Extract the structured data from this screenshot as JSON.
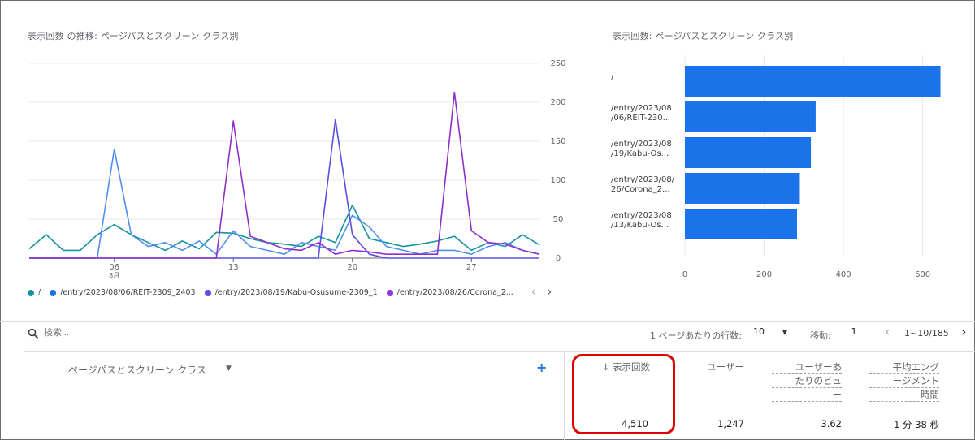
{
  "line_chart": {
    "title": "表示回数 の推移: ページパスとスクリーン クラス別",
    "y_ticks": [
      "250",
      "200",
      "150",
      "100",
      "50",
      "0"
    ],
    "x_ticks": [
      "06",
      "13",
      "20",
      "27"
    ],
    "x_sub": "8月",
    "legend": [
      {
        "label": "/",
        "color": "#1a73e8"
      },
      {
        "label": "/entry/2023/08/06/REIT-2309_2403",
        "color": "#4285f4"
      },
      {
        "label": "/entry/2023/08/19/Kabu-Osusume-2309_1",
        "color": "#5a4fe0"
      },
      {
        "label": "/entry/2023/08/26/Corona_2...",
        "color": "#9334e6"
      }
    ],
    "nav_prev": "‹",
    "nav_next": "›"
  },
  "chart_data": [
    {
      "type": "line",
      "title": "表示回数 の推移: ページパスとスクリーン クラス別",
      "x": [
        "08-01",
        "08-02",
        "08-03",
        "08-04",
        "08-05",
        "08-06",
        "08-07",
        "08-08",
        "08-09",
        "08-10",
        "08-11",
        "08-12",
        "08-13",
        "08-14",
        "08-15",
        "08-16",
        "08-17",
        "08-18",
        "08-19",
        "08-20",
        "08-21",
        "08-22",
        "08-23",
        "08-24",
        "08-25",
        "08-26",
        "08-27",
        "08-28",
        "08-29",
        "08-30",
        "08-31"
      ],
      "ylim": [
        0,
        250
      ],
      "series": [
        {
          "name": "/",
          "color": "#12939a",
          "values": [
            12,
            30,
            10,
            10,
            30,
            43,
            30,
            20,
            10,
            22,
            12,
            33,
            32,
            25,
            20,
            18,
            15,
            28,
            20,
            68,
            25,
            20,
            15,
            18,
            22,
            28,
            10,
            20,
            15,
            30,
            17
          ]
        },
        {
          "name": "/entry/2023/08/06/REIT-2309_2403",
          "color": "#4f8ff0",
          "values": [
            0,
            0,
            0,
            0,
            0,
            140,
            30,
            15,
            20,
            10,
            22,
            5,
            35,
            15,
            10,
            5,
            20,
            15,
            10,
            55,
            40,
            15,
            10,
            5,
            10,
            10,
            5,
            15,
            20,
            10,
            5
          ]
        },
        {
          "name": "/entry/2023/08/19/Kabu-Osusume-2309_1",
          "color": "#5a4fe0",
          "values": [
            0,
            0,
            0,
            0,
            0,
            0,
            0,
            0,
            0,
            0,
            0,
            0,
            0,
            0,
            0,
            0,
            0,
            0,
            178,
            30,
            5,
            0,
            0,
            0,
            0,
            0,
            0,
            0,
            0,
            0,
            0
          ]
        },
        {
          "name": "/entry/2023/08/26/Corona_2...",
          "color": "#8e2fc9",
          "values": [
            0,
            0,
            0,
            0,
            0,
            0,
            0,
            0,
            0,
            0,
            0,
            0,
            176,
            28,
            20,
            12,
            10,
            20,
            5,
            10,
            8,
            5,
            5,
            5,
            5,
            213,
            35,
            20,
            18,
            10,
            5
          ]
        }
      ]
    },
    {
      "type": "bar",
      "title": "表示回数: ページパスとスクリーン クラス別",
      "categories": [
        "/",
        "/entry/2023/08/06/REIT-230...",
        "/entry/2023/08/19/Kabu-Os...",
        "/entry/2023/08/26/Corona_2...",
        "/entry/2023/08/13/Kabu-Os..."
      ],
      "values": [
        645,
        330,
        318,
        290,
        283
      ],
      "xlim": [
        0,
        650
      ],
      "x_ticks": [
        "0",
        "200",
        "400",
        "600"
      ],
      "color": "#1a73e8"
    }
  ],
  "bar_chart": {
    "title": "表示回数: ページパスとスクリーン クラス別",
    "labels": [
      [
        "/"
      ],
      [
        "/entry/2023/08",
        "/06/REIT-230..."
      ],
      [
        "/entry/2023/08",
        "/19/Kabu-Os..."
      ],
      [
        "/entry/2023/08/",
        "26/Corona_2..."
      ],
      [
        "/entry/2023/08",
        "/13/Kabu-Os..."
      ]
    ],
    "x_ticks": [
      "0",
      "200",
      "400",
      "600"
    ]
  },
  "toolbar": {
    "search_placeholder": "検索...",
    "rows_label": "1 ページあたりの行数:",
    "rows_value": "10",
    "goto_label": "移動:",
    "goto_value": "1",
    "range_text": "1~10/185",
    "prev": "‹",
    "next": "›"
  },
  "table": {
    "dimension_header": "ページパスとスクリーン クラス",
    "add_label": "+",
    "sort_arrow": "↓",
    "columns": {
      "views": {
        "label": "表示回数",
        "value": "4,510"
      },
      "users": {
        "label": "ユーザー",
        "value": "1,247"
      },
      "views_per_user": {
        "label_lines": [
          "ユーザーあ",
          "たりのビュ",
          "ー"
        ],
        "value": "3.62"
      },
      "avg_engagement": {
        "label_lines": [
          "平均エング",
          "ージメント",
          "時間"
        ],
        "value": "1 分 38 秒"
      }
    }
  }
}
